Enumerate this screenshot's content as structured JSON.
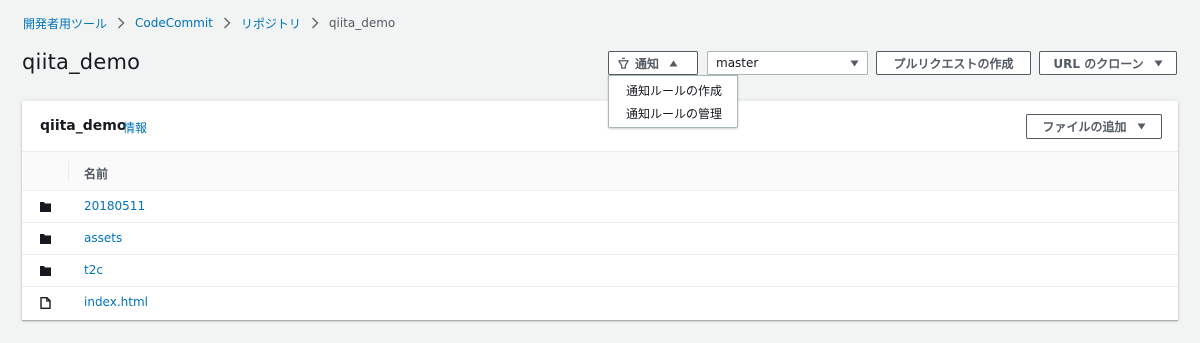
{
  "breadcrumb": {
    "items": [
      "開発者用ツール",
      "CodeCommit",
      "リポジトリ"
    ],
    "current": "qiita_demo"
  },
  "page": {
    "title": "qiita_demo"
  },
  "toolbar": {
    "notify_label": "通知",
    "branch_value": "master",
    "pull_request_label": "プルリクエストの作成",
    "clone_label": "URL のクローン"
  },
  "notify_menu": {
    "items": [
      "通知ルールの作成",
      "通知ルールの管理"
    ]
  },
  "panel": {
    "title": "qiita_demo",
    "info_link": "情報",
    "add_file_label": "ファイルの追加",
    "table": {
      "column_name": "名前",
      "rows": [
        {
          "name": "20180511",
          "icon": "folder-icon"
        },
        {
          "name": "assets",
          "icon": "folder-icon"
        },
        {
          "name": "t2c",
          "icon": "folder-icon"
        },
        {
          "name": "index.html",
          "icon": "file-icon"
        }
      ]
    }
  },
  "colors": {
    "link": "#0073bb",
    "background": "#f2f3f3",
    "text": "#16191f",
    "button_border": "#545b64"
  }
}
